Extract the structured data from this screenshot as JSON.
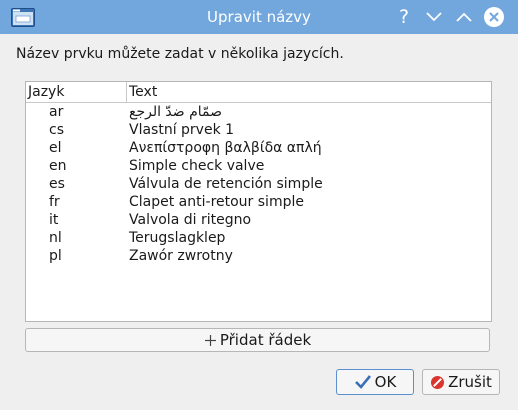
{
  "window": {
    "title": "Upravit názvy"
  },
  "titlebar_buttons": {
    "help": "?"
  },
  "instruction": "Název prvku můžete zadat v několika jazycích.",
  "table": {
    "headers": {
      "language": "Jazyk",
      "text": "Text"
    },
    "rows": [
      {
        "lang": "ar",
        "text": "صمّام ضدّ الرجع"
      },
      {
        "lang": "cs",
        "text": "Vlastní prvek 1"
      },
      {
        "lang": "el",
        "text": "Ανεπίστροφη βαλβίδα απλή"
      },
      {
        "lang": "en",
        "text": "Simple check valve"
      },
      {
        "lang": "es",
        "text": "Válvula de retención simple"
      },
      {
        "lang": "fr",
        "text": "Clapet anti-retour simple"
      },
      {
        "lang": "it",
        "text": "Valvola di ritegno"
      },
      {
        "lang": "nl",
        "text": "Terugslagklep"
      },
      {
        "lang": "pl",
        "text": "Zawór zwrotny"
      }
    ]
  },
  "buttons": {
    "add_row": "Přidat řádek",
    "ok": "OK",
    "cancel": "Zrušit"
  },
  "icons": {
    "app": "window-icon",
    "add": "plus-icon",
    "ok": "checkmark-icon",
    "cancel": "cancel-icon"
  },
  "colors": {
    "titlebar": "#72a7dd",
    "close_x": "#72a7dd",
    "cancel_icon": "#d9352f",
    "ok_check": "#3a6fb7"
  }
}
